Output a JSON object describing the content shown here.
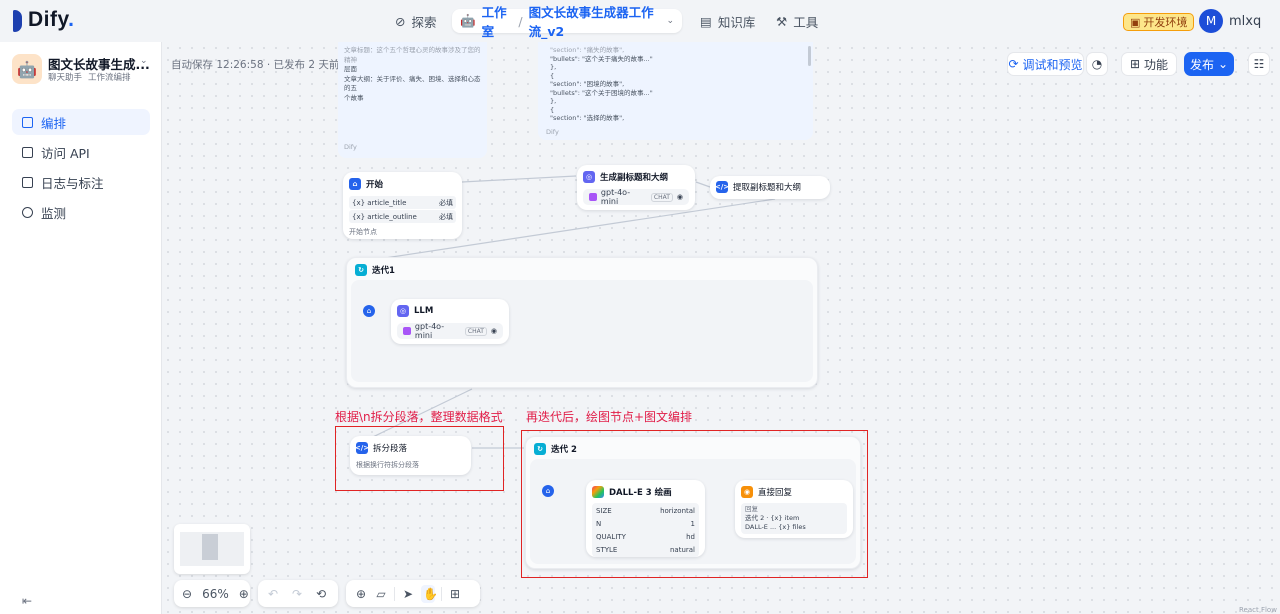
{
  "header": {
    "logo_text": "Dify",
    "logo_dot": ".",
    "explore_label": "探索",
    "workspace_label": "工作室",
    "workflow_name": "图文长故事生成器工作流_v2",
    "knowledge_label": "知识库",
    "tools_label": "工具",
    "env_badge": "开发环境",
    "avatar_letter": "M",
    "username": "mlxq"
  },
  "sidebar": {
    "app_name": "图文长故事生成...",
    "app_type": "聊天助手",
    "app_mode": "工作流编排",
    "items": [
      {
        "label": "编排",
        "active": true
      },
      {
        "label": "访问 API",
        "active": false
      },
      {
        "label": "日志与标注",
        "active": false
      },
      {
        "label": "监测",
        "active": false
      }
    ]
  },
  "toolbar": {
    "autosave": "自动保存 12:26:58 · 已发布 2 天前",
    "debug_label": "调试和预览",
    "features_label": "功能",
    "publish_label": "发布"
  },
  "canvas": {
    "note_left_lines": [
      "文章标题：这个五个哲理心灵的故事涉及了您的精神",
      "层面",
      "文章大纲：关于评价、痛失、困境、选择和心态的五",
      "个故事"
    ],
    "note_left_footer": "Dify",
    "note_right_lines": [
      "\"section\": \"痛失的故事\",",
      "\"bullets\": \"这个关于痛失的故事...\"",
      "},",
      "{",
      "\"section\": \"困境的故事\",",
      "\"bullets\": \"这个关于困境的故事...\"",
      "},",
      "{",
      "\"section\": \"选择的故事\","
    ],
    "note_right_footer": "Dify",
    "start_node": {
      "title": "开始",
      "vars": [
        {
          "name": "article_title",
          "req": "必填"
        },
        {
          "name": "article_outline",
          "req": "必填"
        }
      ],
      "desc": "开始节点"
    },
    "gen_node": {
      "title": "生成副标题和大纲",
      "model": "gpt-4o-mini",
      "tag": "CHAT"
    },
    "extract_node": {
      "title": "提取副标题和大纲"
    },
    "iter1": {
      "title": "迭代1",
      "llm_title": "LLM",
      "model": "gpt-4o-mini",
      "tag": "CHAT"
    },
    "annot_left": "根据\\n拆分段落，整理数据格式",
    "annot_right": "再迭代后，绘图节点+图文编排",
    "split_node": {
      "title": "拆分段落",
      "desc": "根据换行符拆分段落"
    },
    "iter2": {
      "title": "迭代 2",
      "dalle_title": "DALL-E 3 绘画",
      "params": [
        {
          "key": "SIZE",
          "value": "horizontal"
        },
        {
          "key": "N",
          "value": "1"
        },
        {
          "key": "QUALITY",
          "value": "hd"
        },
        {
          "key": "STYLE",
          "value": "natural"
        }
      ],
      "reply_title": "直接回复",
      "reply_label": "回复",
      "reply_line1": "迭代 2 · {x} item",
      "reply_line2": "DALL-E ... {x} files"
    }
  },
  "zoom": {
    "value": "66%"
  },
  "footer": {
    "attribution": "React Flow"
  }
}
